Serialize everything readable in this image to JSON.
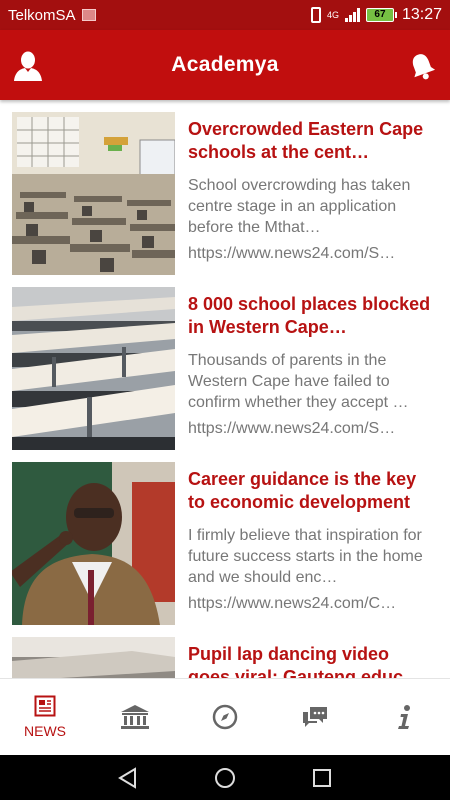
{
  "status_bar": {
    "carrier": "TelkomSA",
    "network": "4G",
    "battery": "67",
    "time": "13:27"
  },
  "app_bar": {
    "title": "Academya",
    "left_icon": "user-profile-icon",
    "right_icon": "bell-icon"
  },
  "articles": [
    {
      "title": "Overcrowded Eastern Cape schools at the cent…",
      "summary": "School overcrowding has taken centre stage in an application before the Mthat…",
      "url": "https://www.news24.com/S…"
    },
    {
      "title": "8 000 school places blocked in Western Cape…",
      "summary": "Thousands of parents in the Western Cape have failed to confirm whether they accept …",
      "url": "https://www.news24.com/S…"
    },
    {
      "title": "Career guidance is the key to economic development",
      "summary": "I firmly believe that inspiration for future success starts in the home and we should enc…",
      "url": "https://www.news24.com/C…"
    },
    {
      "title": "Pupil lap dancing video goes viral: Gauteng educ…",
      "summary": "",
      "url": ""
    }
  ],
  "bottom_nav": {
    "active": "news",
    "items": [
      {
        "label": "NEWS",
        "icon": "newspaper-icon"
      },
      {
        "label": "",
        "icon": "institution-icon"
      },
      {
        "label": "",
        "icon": "compass-icon"
      },
      {
        "label": "",
        "icon": "chat-icon"
      },
      {
        "label": "",
        "icon": "info-icon"
      }
    ]
  },
  "colors": {
    "status_bar": "#a30f0f",
    "app_bar": "#c10e0e",
    "title_text": "#b71212",
    "body_text": "#777777",
    "nav_icon": "#666666"
  }
}
